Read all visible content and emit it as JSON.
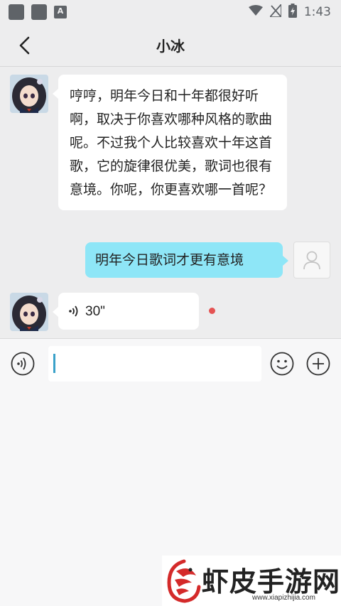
{
  "status_bar": {
    "time": "1:43",
    "icons": [
      "app-notification-icon",
      "app-notification-icon",
      "font-app-icon",
      "wifi-icon",
      "no-signal-icon",
      "battery-charging-icon"
    ]
  },
  "header": {
    "title": "小冰",
    "back_icon": "chevron-left-icon"
  },
  "messages": [
    {
      "from": "bot",
      "text": "哼哼，明年今日和十年都很好听啊，取决于你喜欢哪种风格的歌曲呢。不过我个人比较喜欢十年这首歌，它的旋律很优美，歌词也很有意境。你呢，你更喜欢哪一首呢？"
    },
    {
      "from": "user",
      "text": "明年今日歌词才更有意境"
    },
    {
      "from": "bot",
      "type": "voice",
      "duration": "30\"",
      "unread": true
    }
  ],
  "input_bar": {
    "value": "",
    "placeholder": "",
    "voice_icon": "voice-toggle-icon",
    "emoji_icon": "emoji-icon",
    "plus_icon": "plus-icon"
  },
  "watermark": {
    "text": "虾皮手游网",
    "url": "www.xiapizhijia.com"
  },
  "colors": {
    "background": "#ededee",
    "bot_bubble": "#ffffff",
    "user_bubble": "#8ee6f7",
    "unread_dot": "#e55353",
    "caret": "#3aa1c9"
  }
}
